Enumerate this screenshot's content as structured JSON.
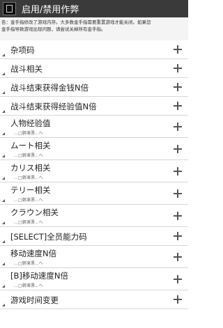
{
  "app": {
    "title": "启用/禁用作弊"
  },
  "warning": {
    "line1": "告：金手指修改了游戏内存。大多数金手指需要重置游戏才能关闭。如果您",
    "line2": "金手指导致游戏出现问题，请尝试关掉所有金手指。"
  },
  "items": [
    {
      "label": "杂项码",
      "sub": ""
    },
    {
      "label": "战斗相关",
      "sub": ""
    },
    {
      "label": "战斗结束获得金钱N倍",
      "sub": ""
    },
    {
      "label": "战斗结束获得经验值N倍",
      "sub": ""
    },
    {
      "label": "人物经验值",
      "sub": "…□朝凍漂…へ"
    },
    {
      "label": "ムート相关",
      "sub": "…□朝凍漂…へ"
    },
    {
      "label": "カリス相关",
      "sub": "…□朝凍漂…へ"
    },
    {
      "label": "テリー相关",
      "sub": "…□朝凍漂…へ"
    },
    {
      "label": "クラウン相关",
      "sub": "…□朝凍漂…へ"
    },
    {
      "label": "[SELECT]全员能力码",
      "sub": ""
    },
    {
      "label": "移动速度N倍",
      "sub": "…□朝凍漂…へ"
    },
    {
      "label": "[B]移动速度N倍",
      "sub": "…□朝凍漂…へ"
    },
    {
      "label": "游戏时间变更",
      "sub": ""
    }
  ]
}
